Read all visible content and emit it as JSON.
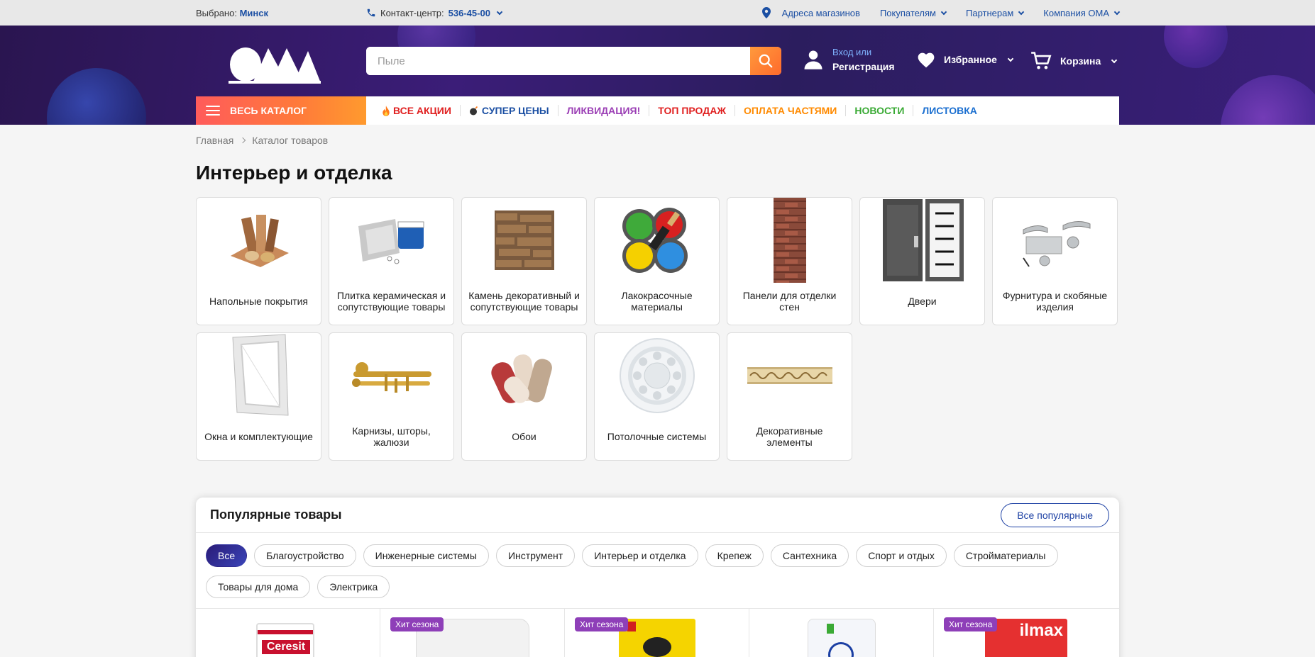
{
  "topbar": {
    "city_prefix": "Выбрано:",
    "city": "Минск",
    "contact_label": "Контакт-центр:",
    "contact_number": "536-45-00",
    "links": [
      "Адреса магазинов",
      "Покупателям",
      "Партнерам",
      "Компания ОМА"
    ]
  },
  "header": {
    "logo_text": "ОМА",
    "search_placeholder": "Пыле",
    "login_line1": "Вход или",
    "login_line2": "Регистрация",
    "favorites": "Избранное",
    "cart": "Корзина"
  },
  "nav": {
    "catalog": "ВЕСЬ КАТАЛОГ",
    "links": [
      {
        "label": "ВСЕ АКЦИИ",
        "color": "#e02020",
        "icon": "fire-icon"
      },
      {
        "label": "СУПЕР ЦЕНЫ",
        "color": "#1b4fa3",
        "icon": "bomb-icon"
      },
      {
        "label": "ЛИКВИДАЦИЯ!",
        "color": "#9b3fb5",
        "icon": ""
      },
      {
        "label": "ТОП ПРОДАЖ",
        "color": "#e02020",
        "icon": ""
      },
      {
        "label": "ОПЛАТА ЧАСТЯМИ",
        "color": "#ff8a00",
        "icon": ""
      },
      {
        "label": "НОВОСТИ",
        "color": "#3aaa35",
        "icon": ""
      },
      {
        "label": "ЛИСТОВКА",
        "color": "#1b6fd0",
        "icon": ""
      }
    ]
  },
  "breadcrumb": [
    "Главная",
    "Каталог товаров"
  ],
  "page_title": "Интерьер и отделка",
  "categories": [
    "Напольные покрытия",
    "Плитка керамическая и сопутствующие товары",
    "Камень декоративный и сопутствующие товары",
    "Лакокрасочные материалы",
    "Панели для отделки стен",
    "Двери",
    "Фурнитура и скобяные изделия",
    "Окна и комплектующие",
    "Карнизы, шторы, жалюзи",
    "Обои",
    "Потолочные системы",
    "Декоративные элементы"
  ],
  "popular": {
    "title": "Популярные товары",
    "all_button": "Все популярные",
    "chips": [
      "Все",
      "Благоустройство",
      "Инженерные системы",
      "Инструмент",
      "Интерьер и отделка",
      "Крепеж",
      "Сантехника",
      "Спорт и отдых",
      "Стройматериалы",
      "Товары для дома",
      "Электрика"
    ],
    "badge": "Хит сезона",
    "product_brands": [
      "Ceresit",
      "",
      "",
      "",
      "ilmax"
    ]
  }
}
